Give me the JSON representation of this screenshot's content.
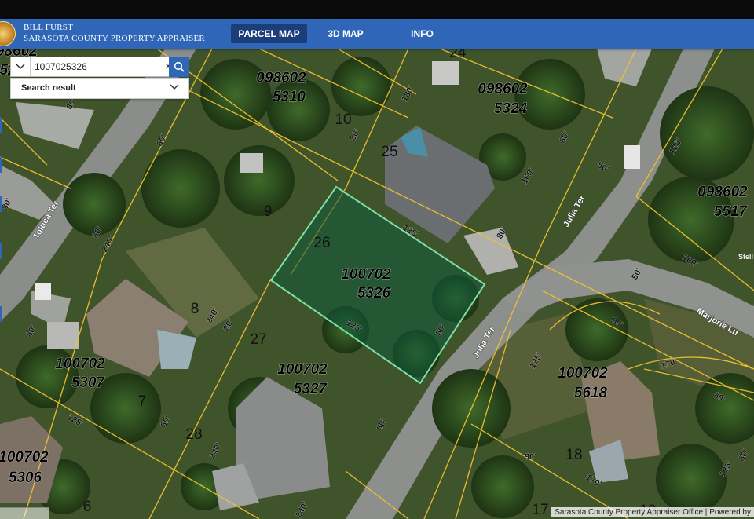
{
  "header": {
    "brand_line1": "BILL FURST",
    "brand_line2": "SARASOTA COUNTY PROPERTY APPRAISER",
    "nav": [
      "PARCEL MAP",
      "3D MAP",
      "INFO"
    ],
    "active_nav": "PARCEL MAP"
  },
  "search": {
    "value": "1007025326",
    "clear_symbol": "×",
    "result_label": "Search result"
  },
  "map": {
    "selected_parcel": "1007025326",
    "attribution": "Sarasota County Property Appraiser Office | Powered by",
    "parcel_line_color": "#f2c230",
    "highlight_color": "#7fe0a4",
    "parcel_labels": [
      {
        "l1": "098602",
        "l2": "5310"
      },
      {
        "l1": "098602",
        "l2": "5324"
      },
      {
        "l1": "098602",
        "l2": "5517"
      },
      {
        "l1": "100702",
        "l2": "5326"
      },
      {
        "l1": "100702",
        "l2": "5307"
      },
      {
        "l1": "100702",
        "l2": "5327"
      },
      {
        "l1": "100702",
        "l2": "5618"
      },
      {
        "l1": "100702",
        "l2": "5306"
      },
      {
        "l1": "098602",
        "l2": "52"
      }
    ],
    "lot_numbers": [
      "10",
      "25",
      "24",
      "9",
      "26",
      "8",
      "27",
      "7",
      "28",
      "6",
      "18",
      "17",
      "19"
    ],
    "dimensions": [
      "80'",
      "180'",
      "80'",
      "80'",
      "125'",
      "160'",
      "50'",
      "126'",
      "80'",
      "240'",
      "80'",
      "240'",
      "125'",
      "80'",
      "80'",
      "100'",
      "50'",
      "90'",
      "125'",
      "170'",
      "80'",
      "80'",
      "125'",
      "240'",
      "80'",
      "240'",
      "90'",
      "170'",
      "80'",
      "80'",
      "80'",
      "125'",
      "80'"
    ],
    "streets": [
      "Toluca Ter",
      "Julia Ter",
      "Julia Ter",
      "Marjorie Ln",
      "Stell"
    ]
  }
}
